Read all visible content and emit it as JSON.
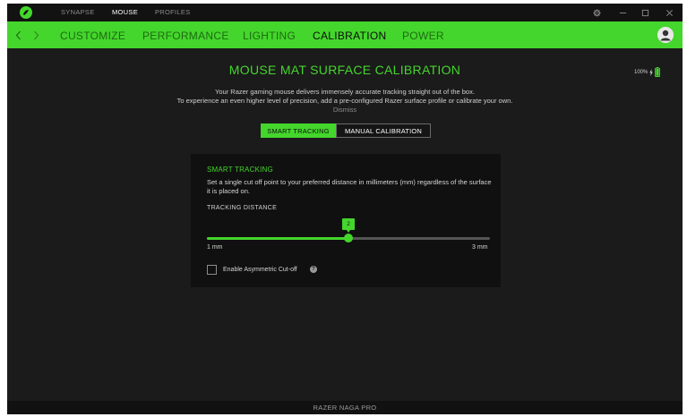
{
  "titlebar": {
    "tabs": [
      {
        "label": "SYNAPSE",
        "active": false
      },
      {
        "label": "MOUSE",
        "active": true
      },
      {
        "label": "PROFILES",
        "active": false
      }
    ],
    "icons": [
      "razer-logo-icon",
      "gear-icon",
      "minimize-icon",
      "maximize-icon",
      "close-icon"
    ]
  },
  "navbar": {
    "tabs": [
      {
        "label": "CUSTOMIZE",
        "active": false
      },
      {
        "label": "PERFORMANCE",
        "active": false
      },
      {
        "label": "LIGHTING",
        "active": false
      },
      {
        "label": "CALIBRATION",
        "active": true
      },
      {
        "label": "POWER",
        "active": false
      }
    ],
    "icons": [
      "chevron-left-icon",
      "chevron-right-icon",
      "user-avatar-icon"
    ]
  },
  "page": {
    "title": "MOUSE MAT SURFACE CALIBRATION",
    "battery_text": "100%",
    "battery_level": 1.0,
    "description_line1": "Your Razer gaming mouse delivers immensely accurate tracking straight out of the box.",
    "description_line2": "To experience an even higher level of precision, add a pre-configured Razer surface profile or calibrate your own.",
    "dismiss_label": "Dismiss",
    "mode_buttons": [
      {
        "label": "SMART TRACKING",
        "active": true
      },
      {
        "label": "MANUAL CALIBRATION",
        "active": false
      }
    ]
  },
  "panel": {
    "title": "SMART TRACKING",
    "description": "Set a single cut off point to your preferred distance in millimeters (mm) regardless of the surface it is placed on.",
    "distance_label": "TRACKING DISTANCE",
    "slider": {
      "min": 1,
      "max": 3,
      "value": 2,
      "value_label": "2",
      "min_label": "1 mm",
      "max_label": "3 mm"
    },
    "checkbox_label": "Enable Asymmetric Cut-off",
    "checkbox_checked": false,
    "info_glyph": "?"
  },
  "footer": {
    "device_name": "RAZER NAGA PRO"
  },
  "colors": {
    "accent": "#44d62c",
    "background": "#1b1b1b",
    "panel": "#101010"
  }
}
